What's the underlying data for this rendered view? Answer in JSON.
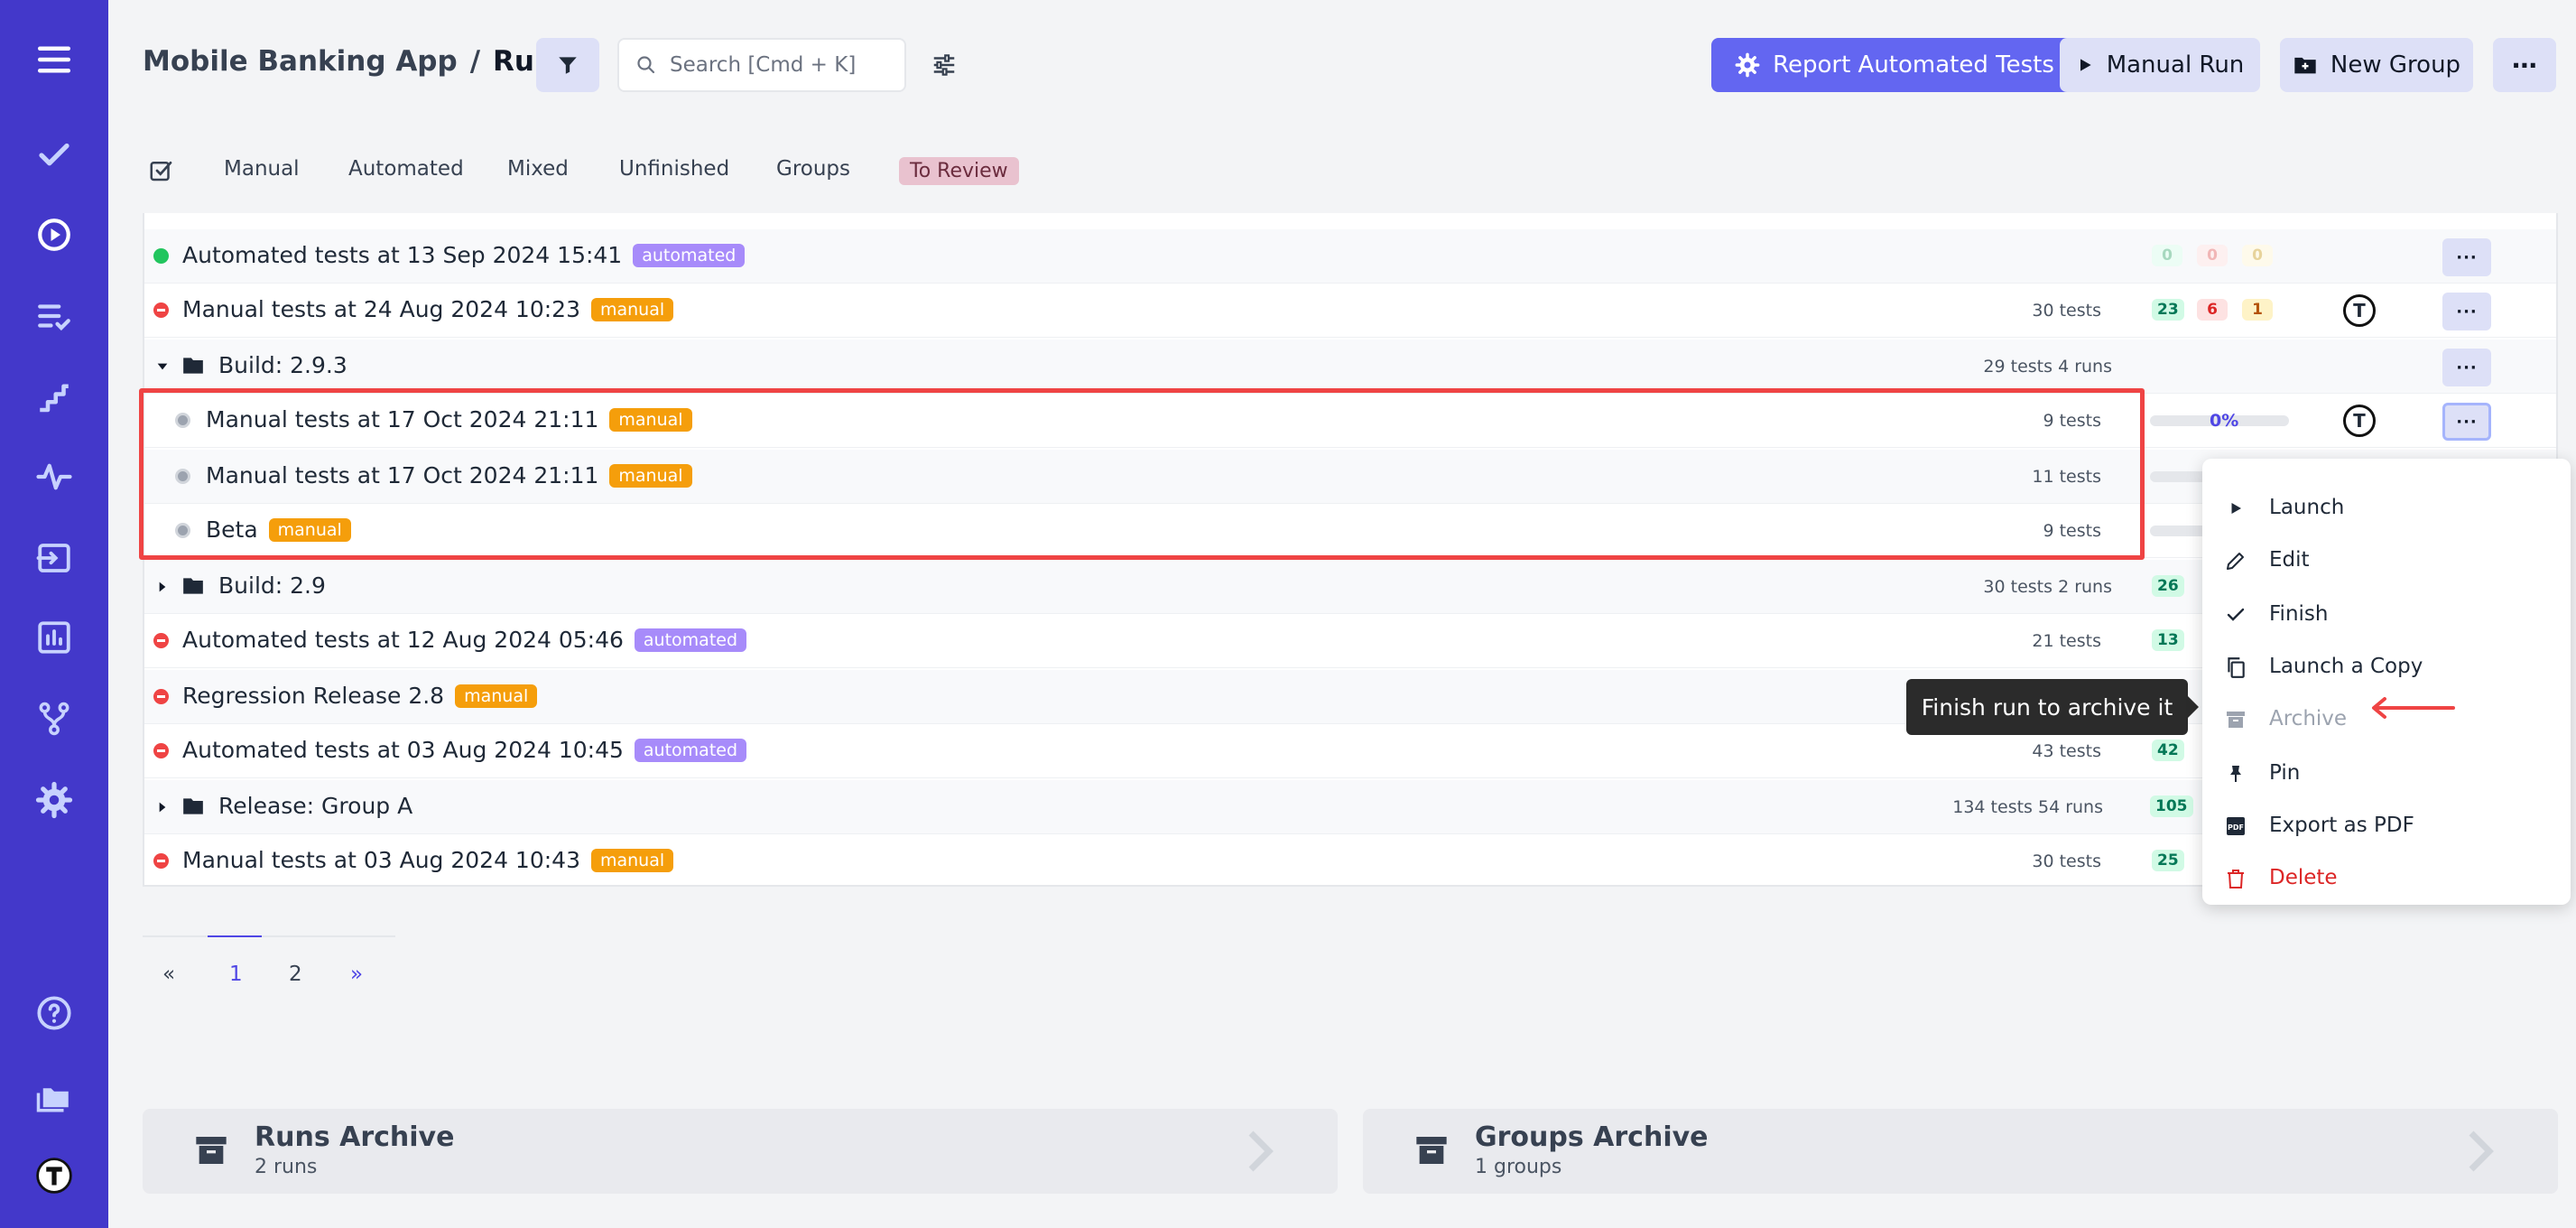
{
  "breadcrumb": {
    "project": "Mobile Banking App",
    "separator": "/",
    "page": "Runs"
  },
  "search": {
    "placeholder": "Search [Cmd + K]"
  },
  "header_buttons": {
    "report": "Report Automated Tests",
    "manual_run": "Manual Run",
    "new_group": "New Group",
    "more": "⋯"
  },
  "tabs": [
    {
      "label": "Manual"
    },
    {
      "label": "Automated"
    },
    {
      "label": "Mixed"
    },
    {
      "label": "Unfinished"
    },
    {
      "label": "Groups"
    },
    {
      "label": "To Review"
    }
  ],
  "rows": [
    {
      "title": "Automated tests at 13 Sep 2024 15:41",
      "tag": "automated",
      "passed": "0",
      "failed": "0",
      "skipped": "0"
    },
    {
      "title": "Manual tests at 24 Aug 2024 10:23",
      "tag": "manual",
      "count": "30 tests",
      "passed": "23",
      "failed": "6",
      "skipped": "1"
    },
    {
      "title": "Build: 2.9.3",
      "count": "29 tests 4 runs"
    },
    {
      "title": "Manual tests at 17 Oct 2024 21:11",
      "tag": "manual",
      "count": "9 tests",
      "progress": "0%"
    },
    {
      "title": "Manual tests at 17 Oct 2024 21:11",
      "tag": "manual",
      "count": "11 tests"
    },
    {
      "title": "Beta",
      "tag": "manual",
      "count": "9 tests"
    },
    {
      "title": "Build: 2.9",
      "count": "30 tests 2 runs",
      "passed": "26"
    },
    {
      "title": "Automated tests at 12 Aug 2024 05:46",
      "tag": "automated",
      "count": "21 tests",
      "passed": "13"
    },
    {
      "title": "Regression Release 2.8",
      "tag": "manual"
    },
    {
      "title": "Automated tests at 03 Aug 2024 10:45",
      "tag": "automated",
      "count": "43 tests",
      "passed": "42"
    },
    {
      "title": "Release: Group A",
      "count": "134 tests 54 runs",
      "passed": "105"
    },
    {
      "title": "Manual tests at 03 Aug 2024 10:43",
      "tag": "manual",
      "count": "30 tests",
      "passed": "25"
    }
  ],
  "row_actions_label": "···",
  "avatar_letter": "T",
  "pagination": {
    "prev": "«",
    "pages": [
      "1",
      "2"
    ],
    "next": "»"
  },
  "archives": {
    "runs": {
      "title": "Runs Archive",
      "subtitle": "2 runs"
    },
    "groups": {
      "title": "Groups Archive",
      "subtitle": "1 groups"
    }
  },
  "menu": [
    {
      "label": "Launch",
      "icon": "play-icon"
    },
    {
      "label": "Edit",
      "icon": "pencil-icon"
    },
    {
      "label": "Finish",
      "icon": "check-icon"
    },
    {
      "label": "Launch a Copy",
      "icon": "copy-icon"
    },
    {
      "label": "Archive",
      "icon": "archive-icon",
      "disabled": true
    },
    {
      "label": "Pin",
      "icon": "pin-icon"
    },
    {
      "label": "Export as PDF",
      "icon": "pdf-icon"
    },
    {
      "label": "Delete",
      "icon": "trash-icon",
      "danger": true
    }
  ],
  "tooltip": "Finish run to archive it",
  "colors": {
    "sidebar": "#4338ca",
    "accent": "#6366f1",
    "danger": "#dc2626",
    "highlight": "#ef4444"
  }
}
